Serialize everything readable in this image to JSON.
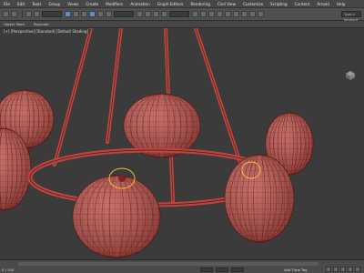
{
  "app": {
    "menu": [
      "File",
      "Edit",
      "Tools",
      "Group",
      "Views",
      "Create",
      "Modifiers",
      "Animation",
      "Graph Editors",
      "Rendering",
      "Civil View",
      "Customize",
      "Scripting",
      "Content",
      "Arnold",
      "Help"
    ],
    "search_placeholder": "Type a keyword or phrase",
    "ribbon_tabs": [
      "Object Paint",
      "Populate"
    ],
    "viewport_label": "[+] [Perspective] [Standard] [Default Shading]",
    "status_left": "0 / 100",
    "status_right": "Add Time Tag"
  },
  "colors": {
    "mesh_fill": "#b9463f",
    "mesh_line": "#5a1410",
    "selected": "#f0c040",
    "background": "#3b3b3b"
  }
}
